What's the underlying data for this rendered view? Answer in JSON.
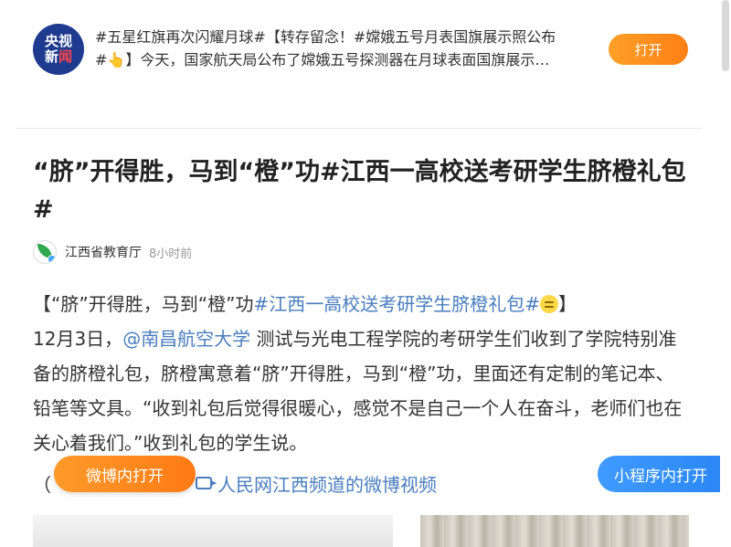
{
  "banner": {
    "logo_line1": "央视",
    "logo_line2_a": "新",
    "logo_line2_b": "闻",
    "text_line1": "#五星红旗再次闪耀月球#【转存留念！#嫦娥五号月表国旗展示照公布",
    "text_line2": "#👆】今天，国家航天局公布了嫦娥五号探测器在月球表面国旗展示…",
    "open_label": "打开"
  },
  "article": {
    "title": "“脐”开得胜，马到“橙”功#江西一高校送考研学生脐橙礼包#",
    "author_name": "江西省教育厅",
    "author_time": "8小时前",
    "body": {
      "p1_prefix": "【“脐”开得胜，马到“橙”功",
      "p1_tag": "#江西一高校送考研学生脐橙礼包#",
      "p1_suffix": "】",
      "p2_date": "12月3日，",
      "p2_mention": "@南昌航空大学",
      "p2_text": " 测试与光电工程学院的考研学生们收到了学院特别准备的脐橙礼包，脐橙寓意着“脐”开得胜，马到“橙”功，里面还有定制的笔记本、铅笔等文具。“收到礼包后觉得很暖心，感觉不是自己一个人在奋斗，老师们也在关心着我们。”收到礼包的学生说。",
      "video_prefix": "（",
      "video_link": "人民网江西频道的微博视频"
    }
  },
  "actions": {
    "weibo_open_label": "微博内打开",
    "miniprogram_open_label": "小程序内打开"
  },
  "colors": {
    "accent_orange": "#ff8a1e",
    "link_blue": "#4a7dbd",
    "mini_blue": "#3a95ff",
    "logo_navy": "#1f3b8f"
  }
}
